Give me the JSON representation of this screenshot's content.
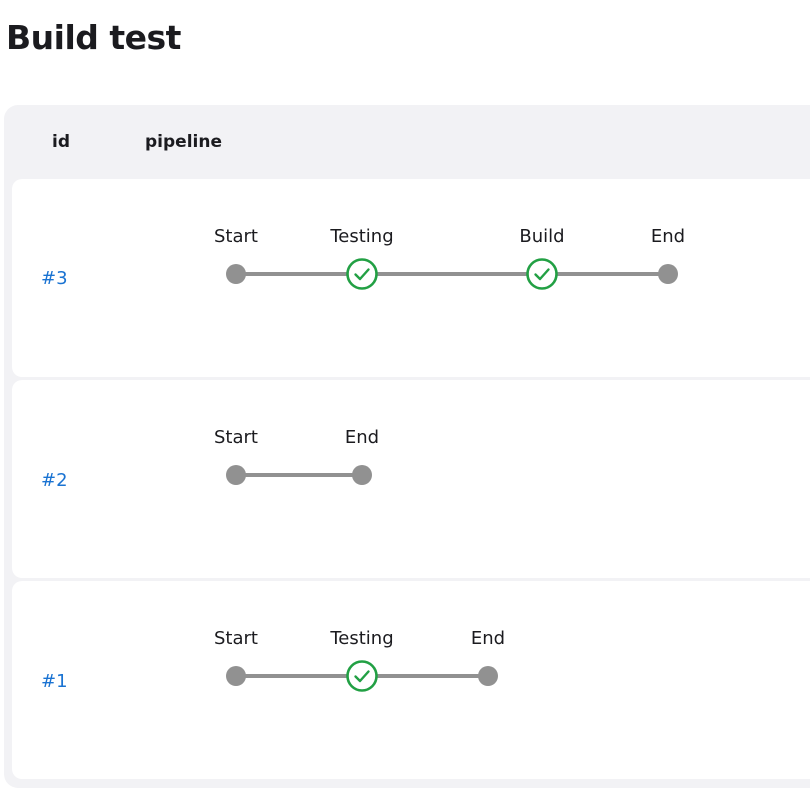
{
  "page": {
    "title": "Build test"
  },
  "table": {
    "columns": {
      "id": "id",
      "pipeline": "pipeline"
    },
    "rows": [
      {
        "id": "#3",
        "stages": [
          {
            "name": "Start",
            "status": "start"
          },
          {
            "name": "Testing",
            "status": "success"
          },
          {
            "name": "Build",
            "status": "success"
          },
          {
            "name": "End",
            "status": "end"
          }
        ]
      },
      {
        "id": "#2",
        "stages": [
          {
            "name": "Start",
            "status": "start"
          },
          {
            "name": "End",
            "status": "end"
          }
        ]
      },
      {
        "id": "#1",
        "stages": [
          {
            "name": "Start",
            "status": "start"
          },
          {
            "name": "Testing",
            "status": "success"
          },
          {
            "name": "End",
            "status": "end"
          }
        ]
      }
    ]
  },
  "colors": {
    "success": "#22a044",
    "track": "#919191",
    "link": "#1a73d2"
  },
  "icons": {
    "success": "check-circle-icon",
    "start": "start-node-icon",
    "end": "end-node-icon"
  }
}
